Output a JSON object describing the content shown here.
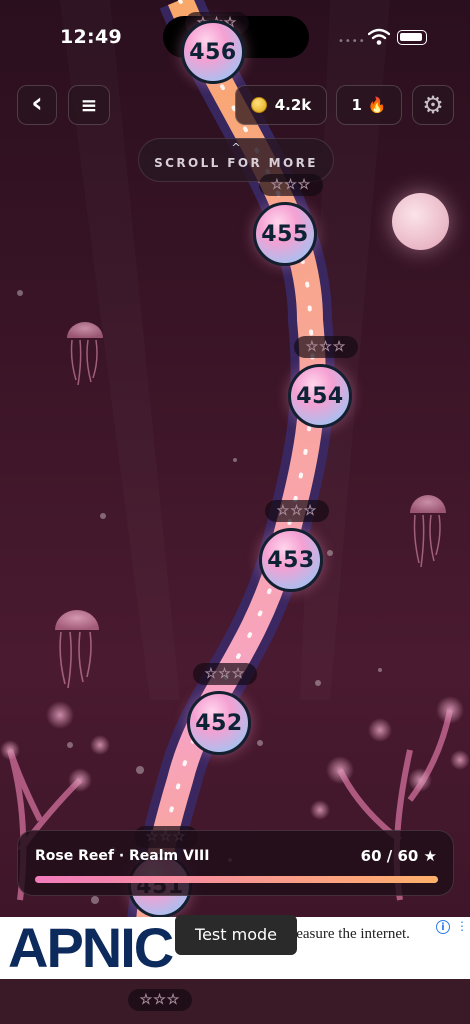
{
  "status_bar": {
    "time": "12:49",
    "signal": "••••"
  },
  "hud": {
    "coins": "4.2k",
    "streak": "1",
    "streak_icon": "🔥",
    "back_icon": "‹",
    "menu_icon": "≡",
    "settings_icon": "⚙"
  },
  "scroll_hint": {
    "caret": "^",
    "label": "SCROLL FOR MORE"
  },
  "levels": [
    {
      "number": "456",
      "stars_earned": 0,
      "stars_total": 3,
      "stars": "☆☆☆"
    },
    {
      "number": "455",
      "stars_earned": 0,
      "stars_total": 3,
      "stars": "☆☆☆"
    },
    {
      "number": "454",
      "stars_earned": 0,
      "stars_total": 3,
      "stars": "☆☆☆"
    },
    {
      "number": "453",
      "stars_earned": 0,
      "stars_total": 3,
      "stars": "☆☆☆"
    },
    {
      "number": "452",
      "stars_earned": 0,
      "stars_total": 3,
      "stars": "☆☆☆"
    },
    {
      "number": "451",
      "stars_earned": 0,
      "stars_total": 3,
      "stars": "☆☆☆"
    }
  ],
  "progress": {
    "realm": "Rose Reef · Realm VIII",
    "stars_text": "60 / 60 ★",
    "fraction": 1.0
  },
  "ad": {
    "logo": "APNIC",
    "text": "r helping us measure the internet.",
    "info_icon": "i",
    "menu_icon": "⋮"
  },
  "toast": {
    "text": "Test mode"
  },
  "colors": {
    "path_pink": "#f7a3c6",
    "path_orange": "#f9a86a",
    "node_border": "#13202f",
    "bar_start": "#f27bbd",
    "bar_end": "#ffb06a"
  }
}
